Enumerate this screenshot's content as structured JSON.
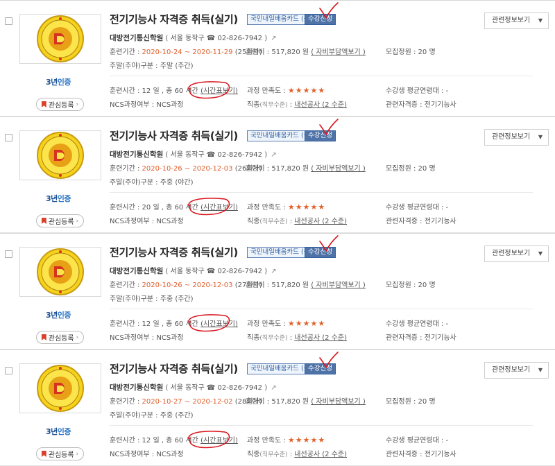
{
  "colors": {
    "date_orange": "#e0602f",
    "badge_blue": "#4f73a7",
    "star_orange": "#e0612b",
    "cert_blue": "#2a74c6",
    "annotation_red": "#d8141b"
  },
  "labels": {
    "card_badge": "국민내일배움카드 (근로자)",
    "apply": "수강신청",
    "related": "관련정보보기",
    "favorite": "관심등록",
    "cert_prefix": "3년",
    "cert_suffix": "인증",
    "period_label": "훈련기간 :",
    "fee_label": "훈련비 :",
    "fee_value": "517,820 원",
    "fee_link": "( 자비부담액보기 )",
    "quota_label": "모집정원 :",
    "quota_value": "20 명",
    "weekday_label": "주말(주야)구분 :",
    "hours_label": "훈련시간 :",
    "timetable": "(시간표보기)",
    "satisfaction_label": "과정 만족도 :",
    "stars": "★★★★★",
    "age_label": "수강생 평균연령대 :",
    "age_value": "-",
    "ncs_label": "NCS과정여부 :",
    "ncs_value": "NCS과정",
    "job_label": "직종",
    "job_sub": "(직무수준)",
    "job_value": "내선공사 (2 수준)",
    "qual_label": "관련자격증 :",
    "qual_value": "전기기능사"
  },
  "courses": [
    {
      "title": "전기기능사 자격증 취득(실기)",
      "org": "대방전기통신학원",
      "location": "( 서울 동작구 ☎ 02-826-7942 )",
      "period": "2020-10-24 ~ 2020-11-29",
      "round": "(25회차)",
      "weekday": "주말 (주간)",
      "hours": "12 일 , 총 60 시간"
    },
    {
      "title": "전기기능사 자격증 취득(실기)",
      "org": "대방전기통신학원",
      "location": "( 서울 동작구 ☎ 02-826-7942 )",
      "period": "2020-10-26 ~ 2020-12-03",
      "round": "(26회차)",
      "weekday": "주중 (야간)",
      "hours": "20 일 , 총 60 시간"
    },
    {
      "title": "전기기능사 자격증 취득(실기)",
      "org": "대방전기통신학원",
      "location": "( 서울 동작구 ☎ 02-826-7942 )",
      "period": "2020-10-26 ~ 2020-12-03",
      "round": "(27회차)",
      "weekday": "주중 (주간)",
      "hours": "12 일 , 총 60 시간"
    },
    {
      "title": "전기기능사 자격증 취득(실기)",
      "org": "대방전기통신학원",
      "location": "( 서울 동작구 ☎ 02-826-7942 )",
      "period": "2020-10-27 ~ 2020-12-02",
      "round": "(28회차)",
      "weekday": "주중 (주간)",
      "hours": "12 일 , 총 60 시간"
    }
  ]
}
